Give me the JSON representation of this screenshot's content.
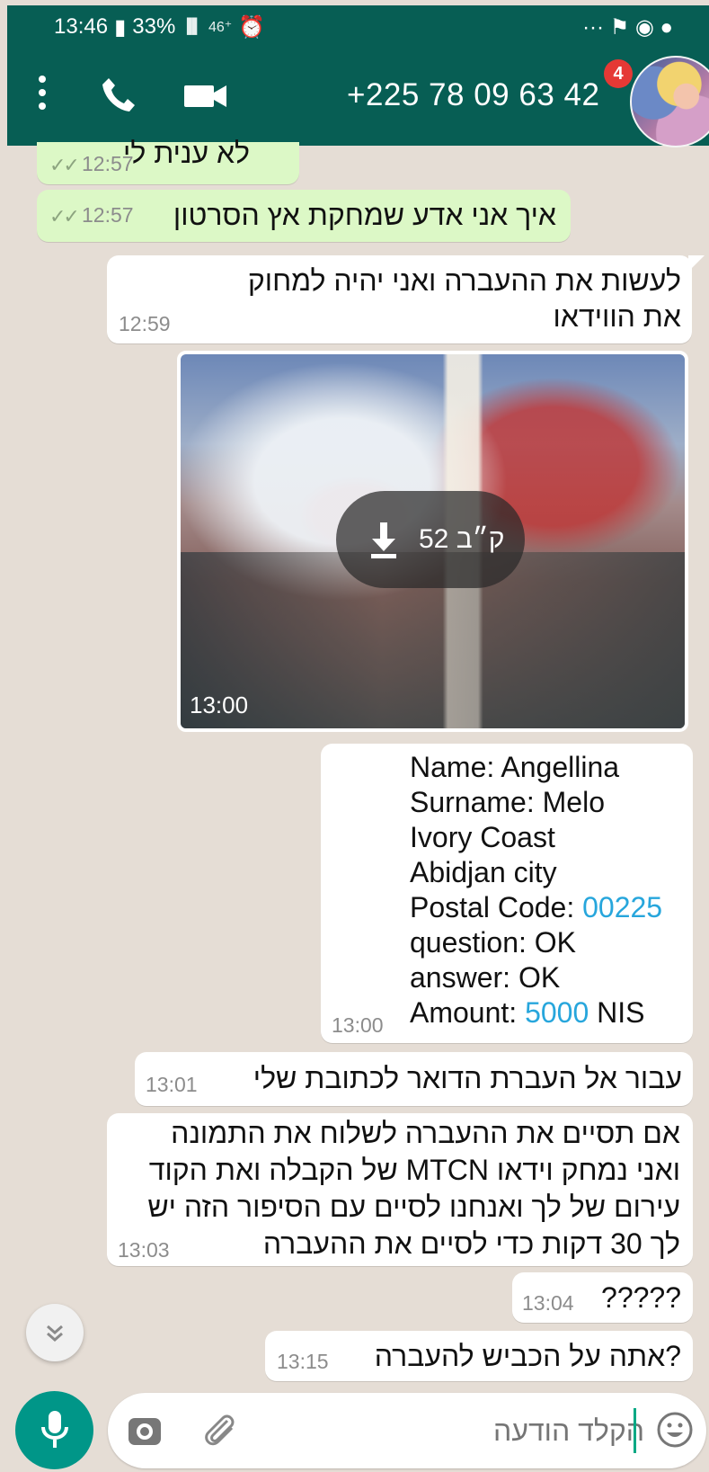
{
  "statusbar": {
    "time": "13:46",
    "battery": "33%",
    "signal": "46⁺",
    "right_icons": "··· ⚑ ◉ ●"
  },
  "header": {
    "contact": "+225 78 09 63 42",
    "badge": "4"
  },
  "messages": {
    "partial": {
      "text": "לא ענית לי",
      "time": "12:57",
      "status_icon": "double-check-icon"
    },
    "m2": {
      "text": "איך אני אדע שמחקת אץ הסרטון",
      "time": "12:57",
      "status_icon": "double-check-icon"
    },
    "m3": {
      "line1": "לעשות את ההעברה ואני יהיה למחוק",
      "line2": "את הווידאו",
      "time": "12:59"
    },
    "video": {
      "download_size": "52 ק״ב",
      "time": "13:00"
    },
    "details": {
      "name": "Name: Angellina",
      "surname": "Surname: Melo",
      "country": "Ivory Coast",
      "city": "Abidjan city",
      "postal_label": "Postal Code: ",
      "postal_code": "00225",
      "question": "question: OK",
      "answer": "answer: OK",
      "amount_label": "Amount: ",
      "amount": "5000",
      "currency": " NIS",
      "time": "13:00"
    },
    "m4": {
      "text": "עבור אל העברת הדואר לכתובת שלי",
      "time": "13:01"
    },
    "m5": {
      "line1": "אם תסיים את ההעברה לשלוח את התמונה",
      "line2": "של הקבלה ואת הקוד MTCN ואני נמחק וידאו",
      "line3": "עירום של לך ואנחנו לסיים עם הסיפור הזה יש",
      "line4": "לך 30 דקות כדי לסיים את ההעברה",
      "time": "13:03"
    },
    "m6": {
      "text": "?????",
      "time": "13:04"
    },
    "m7": {
      "text": "אתה על הכביש להעברה?",
      "time": "13:15"
    }
  },
  "composer": {
    "placeholder": "הקלד הודעה"
  },
  "colors": {
    "header": "#075e54",
    "outgoing": "#dcf8c6",
    "incoming": "#ffffff",
    "chat_background": "#e5ddd5",
    "mic": "#009688",
    "link": "#27a6dc"
  }
}
